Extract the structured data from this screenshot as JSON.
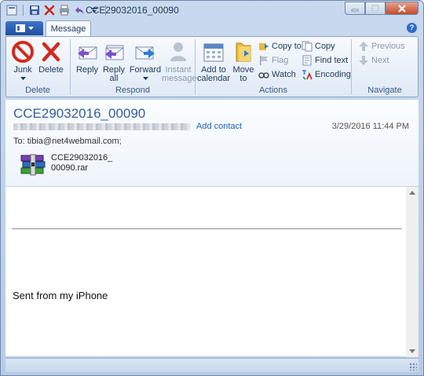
{
  "window": {
    "title": "CCE29032016_00090",
    "qat_icons": [
      "save-icon",
      "delete-icon",
      "reply-icon",
      "customize-icon"
    ]
  },
  "ribbon": {
    "tabs": [
      "Message"
    ],
    "groups": {
      "delete": {
        "label": "Delete",
        "junk": "Junk",
        "delete": "Delete"
      },
      "respond": {
        "label": "Respond",
        "reply": "Reply",
        "reply_all_1": "Reply",
        "reply_all_2": "all",
        "forward": "Forward",
        "instant_message_1": "Instant",
        "instant_message_2": "message"
      },
      "actions": {
        "label": "Actions",
        "add_to_calendar_1": "Add to",
        "add_to_calendar_2": "calendar",
        "move_to_1": "Move",
        "move_to_2": "to",
        "copy_to": "Copy to",
        "flag": "Flag",
        "watch": "Watch",
        "copy": "Copy",
        "find_text": "Find text",
        "encoding": "Encoding"
      },
      "navigate": {
        "label": "Navigate",
        "previous": "Previous",
        "next": "Next"
      }
    }
  },
  "message": {
    "subject": "CCE29032016_00090",
    "add_contact": "Add contact",
    "date": "3/29/2016 11:44 PM",
    "to": "To: tibia@net4webmail.com;",
    "attachment": {
      "name_line1": "CCE29032016_",
      "name_line2": "00090.rar"
    },
    "body_signature": "Sent from my iPhone"
  },
  "colors": {
    "accent": "#345d9d",
    "link": "#1d63b9",
    "ribbon_bg": "#dfe9f5"
  }
}
